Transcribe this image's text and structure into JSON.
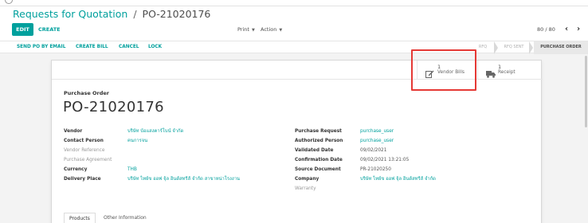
{
  "breadcrumb": {
    "parent": "Requests for Quotation",
    "separator": "/",
    "current": "PO-21020176"
  },
  "toolbar": {
    "edit": "EDIT",
    "create": "CREATE",
    "print": "Print",
    "action": "Action"
  },
  "pager": {
    "value": "80 / 80"
  },
  "status_actions": [
    "SEND PO BY EMAIL",
    "CREATE BILL",
    "CANCEL",
    "LOCK"
  ],
  "stages": [
    "RFQ",
    "RFQ SENT",
    "PURCHASE ORDER"
  ],
  "smart_buttons": {
    "vendor_bills": {
      "count": "1",
      "label": "Vendor Bills"
    },
    "receipt": {
      "count": "1",
      "label": "Receipt"
    }
  },
  "document": {
    "type": "Purchase Order",
    "name": "PO-21020176"
  },
  "left_fields": [
    {
      "label": "Vendor",
      "value": "บริษัท บ้อแสงคาร์โบน์ จำกัด"
    },
    {
      "label": "Contact Person",
      "value": "คนการจน"
    },
    {
      "label": "Vendor Reference",
      "value": ""
    },
    {
      "label": "Purchase Agreement",
      "value": ""
    },
    {
      "label": "Currency",
      "value": "THB"
    },
    {
      "label": "Delivery Place",
      "value": "บริษัท ไทย์ข ออฟ จุ้ล อินดัสทรีส์ จำกัด สาขาหน่าโรงงาน"
    }
  ],
  "right_fields": [
    {
      "label": "Purchase Request",
      "value": "purchase_user"
    },
    {
      "label": "Authorized Person",
      "value": "purchase_user"
    },
    {
      "label": "Validated Date",
      "value": "09/02/2021"
    },
    {
      "label": "Confirmation Date",
      "value": "09/02/2021 13:21:05"
    },
    {
      "label": "Source Document",
      "value": "PR-21020250"
    },
    {
      "label": "Company",
      "value": "บริษัท ไทย์ข ออฟ จุ้ล อินดัสทรีส์ จำกัด"
    },
    {
      "label": "Warranty",
      "value": ""
    }
  ],
  "tabs": [
    "Products",
    "Other Information"
  ],
  "colors": {
    "accent": "#00a09d",
    "highlight": "#e53935"
  }
}
